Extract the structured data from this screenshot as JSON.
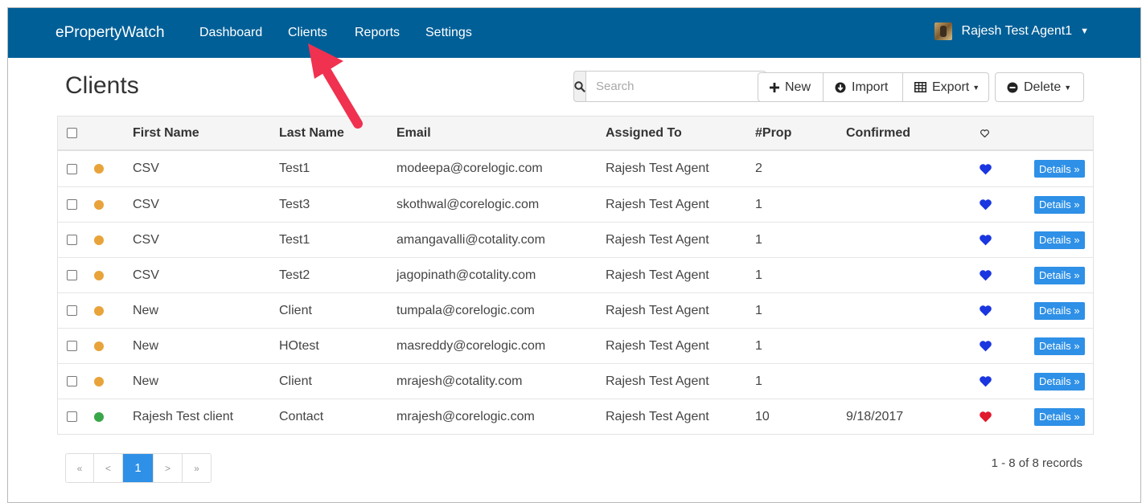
{
  "navbar": {
    "brand": "ePropertyWatch",
    "links": [
      "Dashboard",
      "Clients",
      "Reports",
      "Settings"
    ],
    "user_name": "Rajesh Test Agent1",
    "color": "#005f97"
  },
  "page": {
    "title": "Clients"
  },
  "search": {
    "placeholder": "Search",
    "icon": "search-icon"
  },
  "toolbar": {
    "new_label": "New",
    "import_label": "Import",
    "export_label": "Export",
    "delete_label": "Delete"
  },
  "table": {
    "headers": {
      "first_name": "First Name",
      "last_name": "Last Name",
      "email": "Email",
      "assigned_to": "Assigned To",
      "prop": "#Prop",
      "confirmed": "Confirmed",
      "favorite_icon": "heart-outline-icon"
    },
    "details_label": "Details »",
    "rows": [
      {
        "status": "#e8a33a",
        "first": "CSV",
        "last": "Test1",
        "email": "modeepa@corelogic.com",
        "assigned": "Rajesh Test Agent",
        "prop": "2",
        "confirmed": "",
        "heart": "#1a36e0"
      },
      {
        "status": "#e8a33a",
        "first": "CSV",
        "last": "Test3",
        "email": "skothwal@corelogic.com",
        "assigned": "Rajesh Test Agent",
        "prop": "1",
        "confirmed": "",
        "heart": "#1a36e0"
      },
      {
        "status": "#e8a33a",
        "first": "CSV",
        "last": "Test1",
        "email": "amangavalli@cotality.com",
        "assigned": "Rajesh Test Agent",
        "prop": "1",
        "confirmed": "",
        "heart": "#1a36e0"
      },
      {
        "status": "#e8a33a",
        "first": "CSV",
        "last": "Test2",
        "email": "jagopinath@cotality.com",
        "assigned": "Rajesh Test Agent",
        "prop": "1",
        "confirmed": "",
        "heart": "#1a36e0"
      },
      {
        "status": "#e8a33a",
        "first": "New",
        "last": "Client",
        "email": "tumpala@corelogic.com",
        "assigned": "Rajesh Test Agent",
        "prop": "1",
        "confirmed": "",
        "heart": "#1a36e0"
      },
      {
        "status": "#e8a33a",
        "first": "New",
        "last": "HOtest",
        "email": "masreddy@corelogic.com",
        "assigned": "Rajesh Test Agent",
        "prop": "1",
        "confirmed": "",
        "heart": "#1a36e0"
      },
      {
        "status": "#e8a33a",
        "first": "New",
        "last": "Client",
        "email": "mrajesh@cotality.com",
        "assigned": "Rajesh Test Agent",
        "prop": "1",
        "confirmed": "",
        "heart": "#1a36e0"
      },
      {
        "status": "#3aa64a",
        "first": "Rajesh Test client",
        "last": "Contact",
        "email": "mrajesh@corelogic.com",
        "assigned": "Rajesh Test Agent",
        "prop": "10",
        "confirmed": "9/18/2017",
        "heart": "#e0192d"
      }
    ]
  },
  "pagination": {
    "first": "«",
    "prev": "<",
    "current": "1",
    "next": ">",
    "last": "»",
    "records": "1 - 8 of 8 records"
  },
  "annotation": {
    "arrow_color": "#f0314f"
  }
}
